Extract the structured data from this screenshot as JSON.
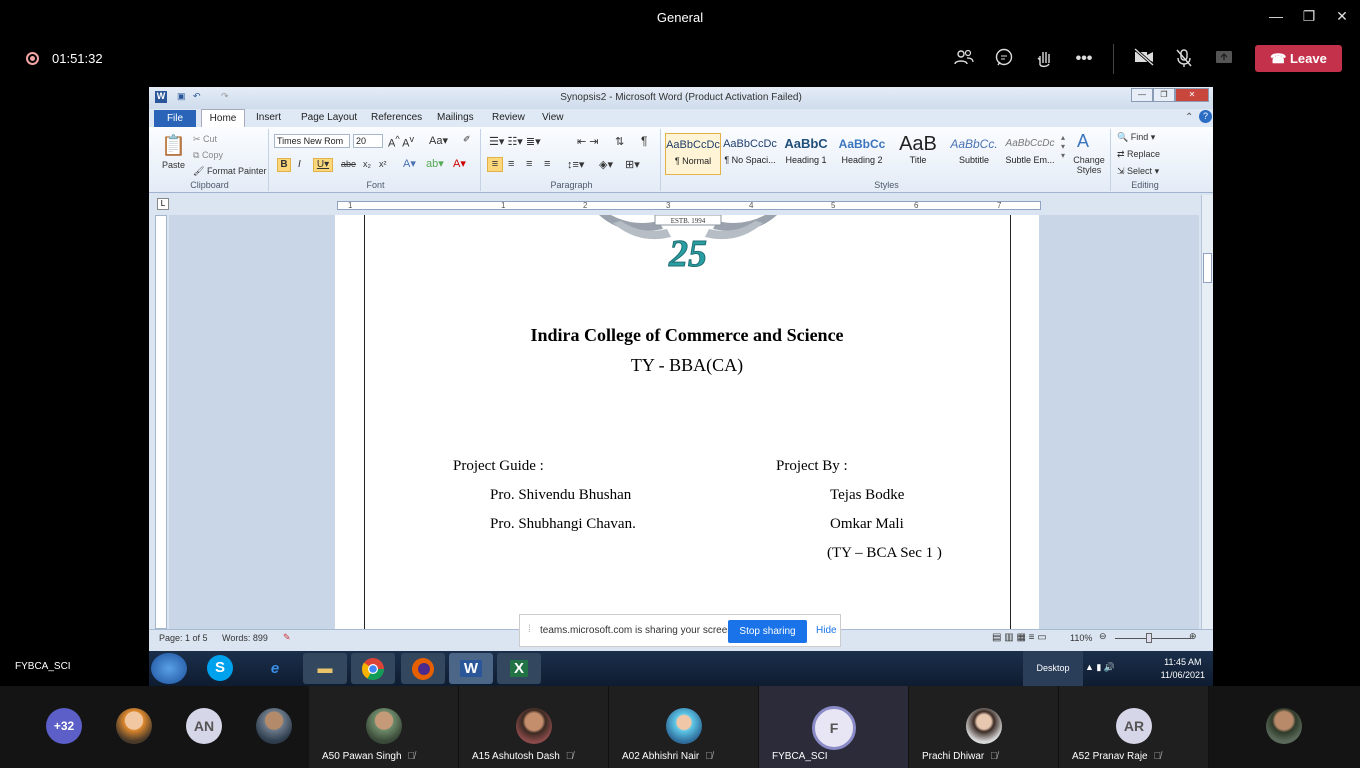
{
  "teams": {
    "title": "General",
    "timer": "01:51:32",
    "leave_label": "Leave",
    "self_label": "FYBCA_SCI",
    "accent_leave": "#c4314b",
    "icons": [
      "people-icon",
      "chat-icon",
      "raise-hand-icon",
      "more-icon",
      "camera-off-icon",
      "mic-off-icon",
      "share-tray-icon"
    ]
  },
  "word": {
    "title": "Synopsis2 - Microsoft Word (Product Activation Failed)",
    "tabs": [
      "File",
      "Home",
      "Insert",
      "Page Layout",
      "References",
      "Mailings",
      "Review",
      "View"
    ],
    "clipboard": {
      "paste": "Paste",
      "cut": "Cut",
      "copy": "Copy",
      "format_painter": "Format Painter",
      "label": "Clipboard"
    },
    "font": {
      "name": "Times New Rom",
      "size": "20",
      "label": "Font"
    },
    "paragraph_label": "Paragraph",
    "styles": [
      {
        "preview": "AaBbCcDc",
        "name": "¶ Normal"
      },
      {
        "preview": "AaBbCcDc",
        "name": "¶ No Spaci..."
      },
      {
        "preview": "AaBbC",
        "name": "Heading 1"
      },
      {
        "preview": "AaBbCc",
        "name": "Heading 2"
      },
      {
        "preview": "AaB",
        "name": "Title"
      },
      {
        "preview": "AaBbCc.",
        "name": "Subtitle"
      },
      {
        "preview": "AaBbCcDc",
        "name": "Subtle Em..."
      }
    ],
    "change_styles": "Change Styles",
    "styles_label": "Styles",
    "editing": {
      "find": "Find",
      "replace": "Replace",
      "select": "Select",
      "label": "Editing"
    },
    "status": {
      "page": "Page: 1 of 5",
      "words": "Words: 899",
      "zoom": "110%"
    },
    "ruler_numbers": [
      "1",
      "1",
      "2",
      "3",
      "4",
      "5",
      "6",
      "7"
    ]
  },
  "document": {
    "logo_estb": "ESTB. 1994",
    "logo_number": "25",
    "college": "Indira College of Commerce and Science",
    "course": "TY  -  BBA(CA)",
    "guide_heading": "Project Guide :",
    "guide_1": "Pro.  Shivendu Bhushan",
    "guide_2": "Pro. Shubhangi Chavan.",
    "by_heading": "Project By :",
    "by_1": "Tejas Bodke",
    "by_2": "Omkar Mali",
    "by_3": "(TY – BCA Sec 1 )"
  },
  "sharebar": {
    "message": "teams.microsoft.com is sharing your screen.",
    "stop": "Stop sharing",
    "hide": "Hide"
  },
  "taskbar": {
    "desktop": "Desktop",
    "time": "11:45 AM",
    "date": "11/06/2021"
  },
  "participants": {
    "overflow": "+32",
    "an_initials": "AN",
    "tiles": [
      {
        "name": "A50 Pawan Singh"
      },
      {
        "name": "A15 Ashutosh Dash"
      },
      {
        "name": "A02 Abhishri Nair"
      },
      {
        "name": "FYBCA_SCI",
        "initial": "F"
      },
      {
        "name": "Prachi Dhiwar"
      },
      {
        "name": "A52 Pranav Raje",
        "initial": "AR"
      }
    ]
  }
}
